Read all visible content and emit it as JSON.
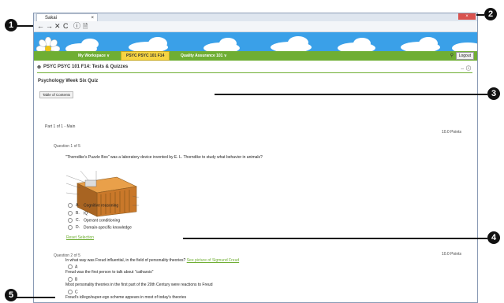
{
  "browser": {
    "tab_title": "Sakai",
    "tab_close": "×",
    "window_close": "×",
    "nav_icons": [
      "←",
      "→",
      "✕",
      "C",
      "ⓘ",
      "🗎"
    ]
  },
  "site_menu": {
    "my_workspace": "My Workspace ∨",
    "active_site": "PSYC PSYC 101 F14",
    "quality": "Quality Assurance 101 ∨",
    "logout": "Logout"
  },
  "tool": {
    "title": "PSYC PSYC 101 F14: Tests & Quizzes",
    "right_icons": "⇔ ⓘ"
  },
  "quiz": {
    "title": "Psychology Week Six Quiz",
    "toc_button": "Table of Contents",
    "part": "Part 1 of 1 - Main",
    "q1": {
      "label": "Question 1 of 5",
      "points": "10.0 Points",
      "text": "\"Thorndike's Puzzle Box\" was a laboratory device invented by E. L. Thorndike to study what behavior in animals?",
      "choices": [
        {
          "letter": "A.",
          "text": "Cognitive reasoning"
        },
        {
          "letter": "B.",
          "text": "IQ"
        },
        {
          "letter": "C.",
          "text": "Operant conditioning"
        },
        {
          "letter": "D.",
          "text": "Domain-specific knowledge"
        }
      ],
      "reset": "Reset Selection"
    },
    "q2": {
      "label": "Question 2 of 5",
      "points": "10.0 Points",
      "text": "In what way was Freud influential, in the field of personality theories?",
      "link": "See picture of Sigmund Freud",
      "statements": [
        {
          "letter": "A",
          "text": "Freud was the first person to talk about \"catharsis\""
        },
        {
          "letter": "B",
          "text": "Most personality theories in the first part of the 20th Century were reactions to Freud"
        },
        {
          "letter": "C",
          "text": "Freud's id/ego/super-ego scheme appears in most of today's theories"
        }
      ]
    }
  },
  "callouts": [
    "1",
    "2",
    "3",
    "4",
    "5"
  ]
}
